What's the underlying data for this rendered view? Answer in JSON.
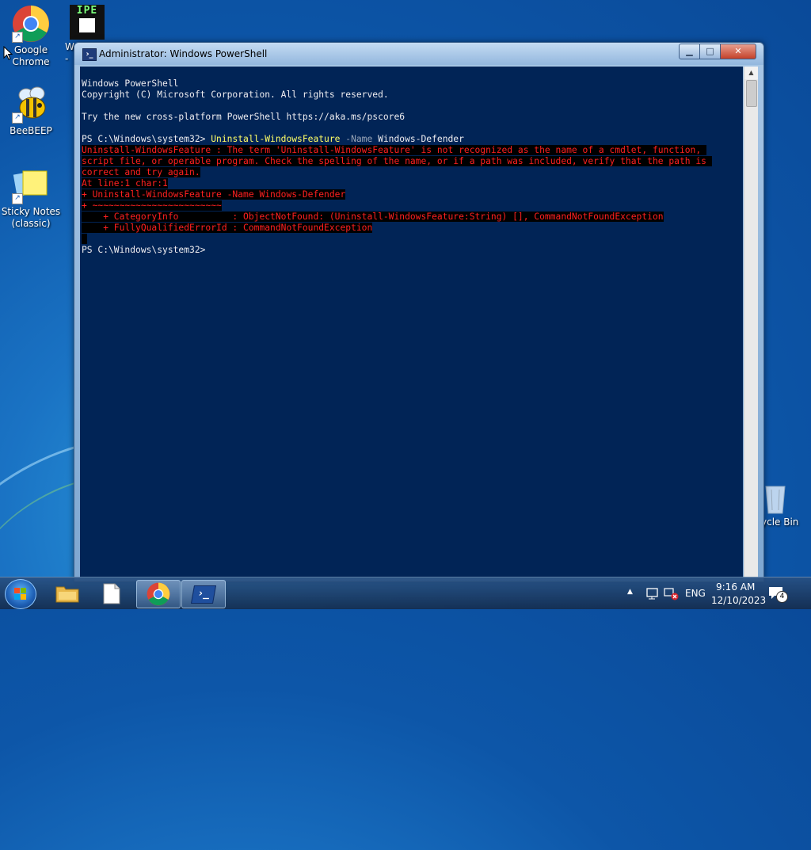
{
  "desktop": {
    "icons": [
      {
        "label_line1": "Google",
        "label_line2": "Chrome",
        "icon": "chrome-icon"
      },
      {
        "label_line1": "W",
        "label_line2": "-",
        "icon": "ipe-icon"
      },
      {
        "label_line1": "BeeBEEP",
        "label_line2": "",
        "icon": "bee-icon"
      },
      {
        "label_line1": "Sticky Notes",
        "label_line2": "(classic)",
        "icon": "sticky-notes-icon"
      },
      {
        "label_line1": "ycle Bin",
        "label_line2": "",
        "icon": "recycle-bin-icon"
      }
    ]
  },
  "window": {
    "title": "Administrator: Windows PowerShell",
    "icon": "powershell-icon"
  },
  "console": {
    "line1": "Windows PowerShell",
    "line2": "Copyright (C) Microsoft Corporation. All rights reserved.",
    "line3": "Try the new cross-platform PowerShell https://aka.ms/pscore6",
    "prompt1": "PS C:\\Windows\\system32> ",
    "cmd_name": "Uninstall-WindowsFeature",
    "cmd_param": " -Name",
    "cmd_value": " Windows-Defender",
    "err1": "Uninstall-WindowsFeature : The term 'Uninstall-WindowsFeature' is not recognized as the name of a cmdlet, function, ",
    "err2": "script file, or operable program. Check the spelling of the name, or if a path was included, verify that the path is ",
    "err3": "correct and try again.",
    "err4": "At line:1 char:1",
    "err5": "+ Uninstall-WindowsFeature -Name Windows-Defender",
    "err6": "+ ~~~~~~~~~~~~~~~~~~~~~~~~",
    "err7": "    + CategoryInfo          : ObjectNotFound: (Uninstall-WindowsFeature:String) [], CommandNotFoundException",
    "err8": "    + FullyQualifiedErrorId : CommandNotFoundException",
    "prompt2": "PS C:\\Windows\\system32> "
  },
  "taskbar": {
    "items": [
      "start-button",
      "file-explorer",
      "notepad",
      "chrome",
      "powershell"
    ],
    "active": "powershell",
    "language": "ENG",
    "time": "9:16 AM",
    "date": "12/10/2023",
    "notifications_count": "4"
  },
  "colors": {
    "console_bg": "#012456",
    "console_fg": "#eeedf0",
    "error_fg": "#ff2020",
    "command_fg": "#ffff66"
  }
}
